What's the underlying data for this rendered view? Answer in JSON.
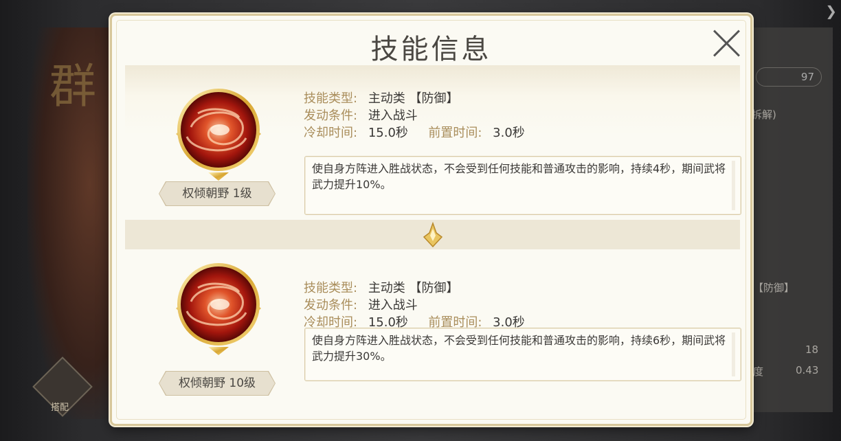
{
  "background": {
    "glyph": "群",
    "stat_value": "97",
    "partial_text_1": "拆解)",
    "partial_text_2": "【防御】",
    "stat_18": "18",
    "stat_043": "0.43",
    "stat_partial_label": "度",
    "equip_label": "搭配"
  },
  "dialog": {
    "title": "技能信息"
  },
  "skills": [
    {
      "name": "权倾朝野 1级",
      "type_label": "技能类型:",
      "type_value": "主动类 【防御】",
      "trigger_label": "发动条件:",
      "trigger_value": "进入战斗",
      "cooldown_label": "冷却时间:",
      "cooldown_value": "15.0秒",
      "precast_label": "前置时间:",
      "precast_value": "3.0秒",
      "description": "使自身方阵进入胜战状态，不会受到任何技能和普通攻击的影响，持续4秒，期间武将武力提升10%。"
    },
    {
      "name": "权倾朝野 10级",
      "type_label": "技能类型:",
      "type_value": "主动类 【防御】",
      "trigger_label": "发动条件:",
      "trigger_value": "进入战斗",
      "cooldown_label": "冷却时间:",
      "cooldown_value": "15.0秒",
      "precast_label": "前置时间:",
      "precast_value": "3.0秒",
      "description": "使自身方阵进入胜战状态，不会受到任何技能和普通攻击的影响，持续6秒，期间武将武力提升30%。"
    }
  ],
  "icons": {
    "close": "close-icon",
    "skill": "swirl-skill-icon",
    "divider": "down-arrow-icon"
  },
  "colors": {
    "label": "#a98d5b",
    "text": "#3a3836",
    "panel": "#fbfaf3",
    "gold": "#d7c79a"
  }
}
